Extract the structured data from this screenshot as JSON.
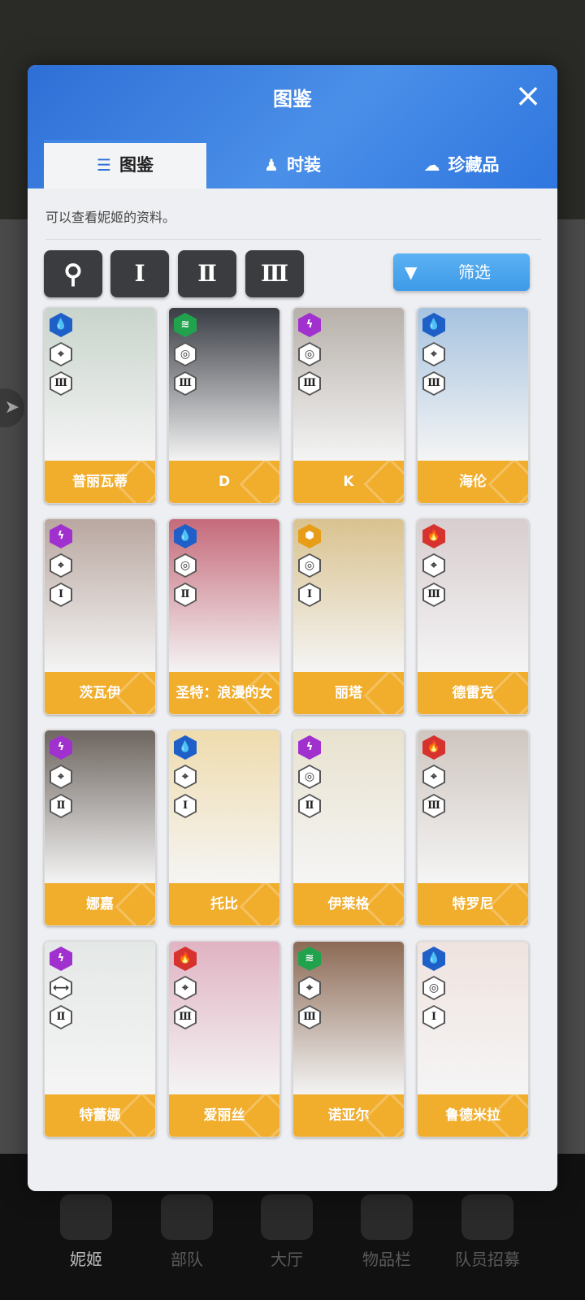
{
  "modal": {
    "title": "图鉴",
    "close_icon": "×",
    "description": "可以查看妮姬的资料。"
  },
  "tabs": [
    {
      "label": "图鉴",
      "icon": "☰",
      "active": true
    },
    {
      "label": "时装",
      "icon": "♟",
      "active": false
    },
    {
      "label": "珍藏品",
      "icon": "☁",
      "active": false
    }
  ],
  "controls": {
    "search_icon": "⚲",
    "burst_1": "Ⅰ",
    "burst_2": "Ⅱ",
    "burst_3": "Ⅲ",
    "filter_label": "筛选",
    "filter_icon": "▼"
  },
  "characters": [
    {
      "name": "普丽瓦蒂",
      "element": "water",
      "class_icon": "⌖",
      "burst": "Ⅲ",
      "color": "#c9d4cc"
    },
    {
      "name": "D",
      "element": "wind",
      "class_icon": "◎",
      "burst": "Ⅲ",
      "color": "#3a3d45"
    },
    {
      "name": "K",
      "element": "elec",
      "class_icon": "◎",
      "burst": "Ⅲ",
      "color": "#b7b0aa"
    },
    {
      "name": "海伦",
      "element": "water",
      "class_icon": "⌖",
      "burst": "Ⅲ",
      "color": "#a7c3df"
    },
    {
      "name": "茨瓦伊",
      "element": "elec",
      "class_icon": "⌖",
      "burst": "Ⅰ",
      "color": "#b9a7a0"
    },
    {
      "name": "圣特：浪漫的女",
      "element": "water",
      "class_icon": "◎",
      "burst": "Ⅱ",
      "color": "#c56a7a"
    },
    {
      "name": "丽塔",
      "element": "iron",
      "class_icon": "◎",
      "burst": "Ⅰ",
      "color": "#d9c28f"
    },
    {
      "name": "德雷克",
      "element": "fire",
      "class_icon": "⌖",
      "burst": "Ⅲ",
      "color": "#d8cdcf"
    },
    {
      "name": "娜嘉",
      "element": "elec",
      "class_icon": "⌖",
      "burst": "Ⅱ",
      "color": "#6e6660"
    },
    {
      "name": "托比",
      "element": "water",
      "class_icon": "⌖",
      "burst": "Ⅰ",
      "color": "#efdcae"
    },
    {
      "name": "伊莱格",
      "element": "elec",
      "class_icon": "◎",
      "burst": "Ⅱ",
      "color": "#e8e2cf"
    },
    {
      "name": "特罗尼",
      "element": "fire",
      "class_icon": "⌖",
      "burst": "Ⅲ",
      "color": "#cfc6c0"
    },
    {
      "name": "特蕾娜",
      "element": "elec",
      "class_icon": "⟷",
      "burst": "Ⅱ",
      "color": "#e4e8e6"
    },
    {
      "name": "爱丽丝",
      "element": "fire",
      "class_icon": "⌖",
      "burst": "Ⅲ",
      "color": "#e0b3c3"
    },
    {
      "name": "诺亚尔",
      "element": "wind",
      "class_icon": "⌖",
      "burst": "Ⅲ",
      "color": "#8c6a55"
    },
    {
      "name": "鲁德米拉",
      "element": "water",
      "class_icon": "◎",
      "burst": "Ⅰ",
      "color": "#efe3df"
    }
  ],
  "element_icons": {
    "water": "💧",
    "wind": "≋",
    "elec": "ϟ",
    "iron": "⬢",
    "fire": "🔥"
  },
  "background_nav": [
    "妮姬",
    "部队",
    "大厅",
    "物品栏",
    "队员招募"
  ]
}
